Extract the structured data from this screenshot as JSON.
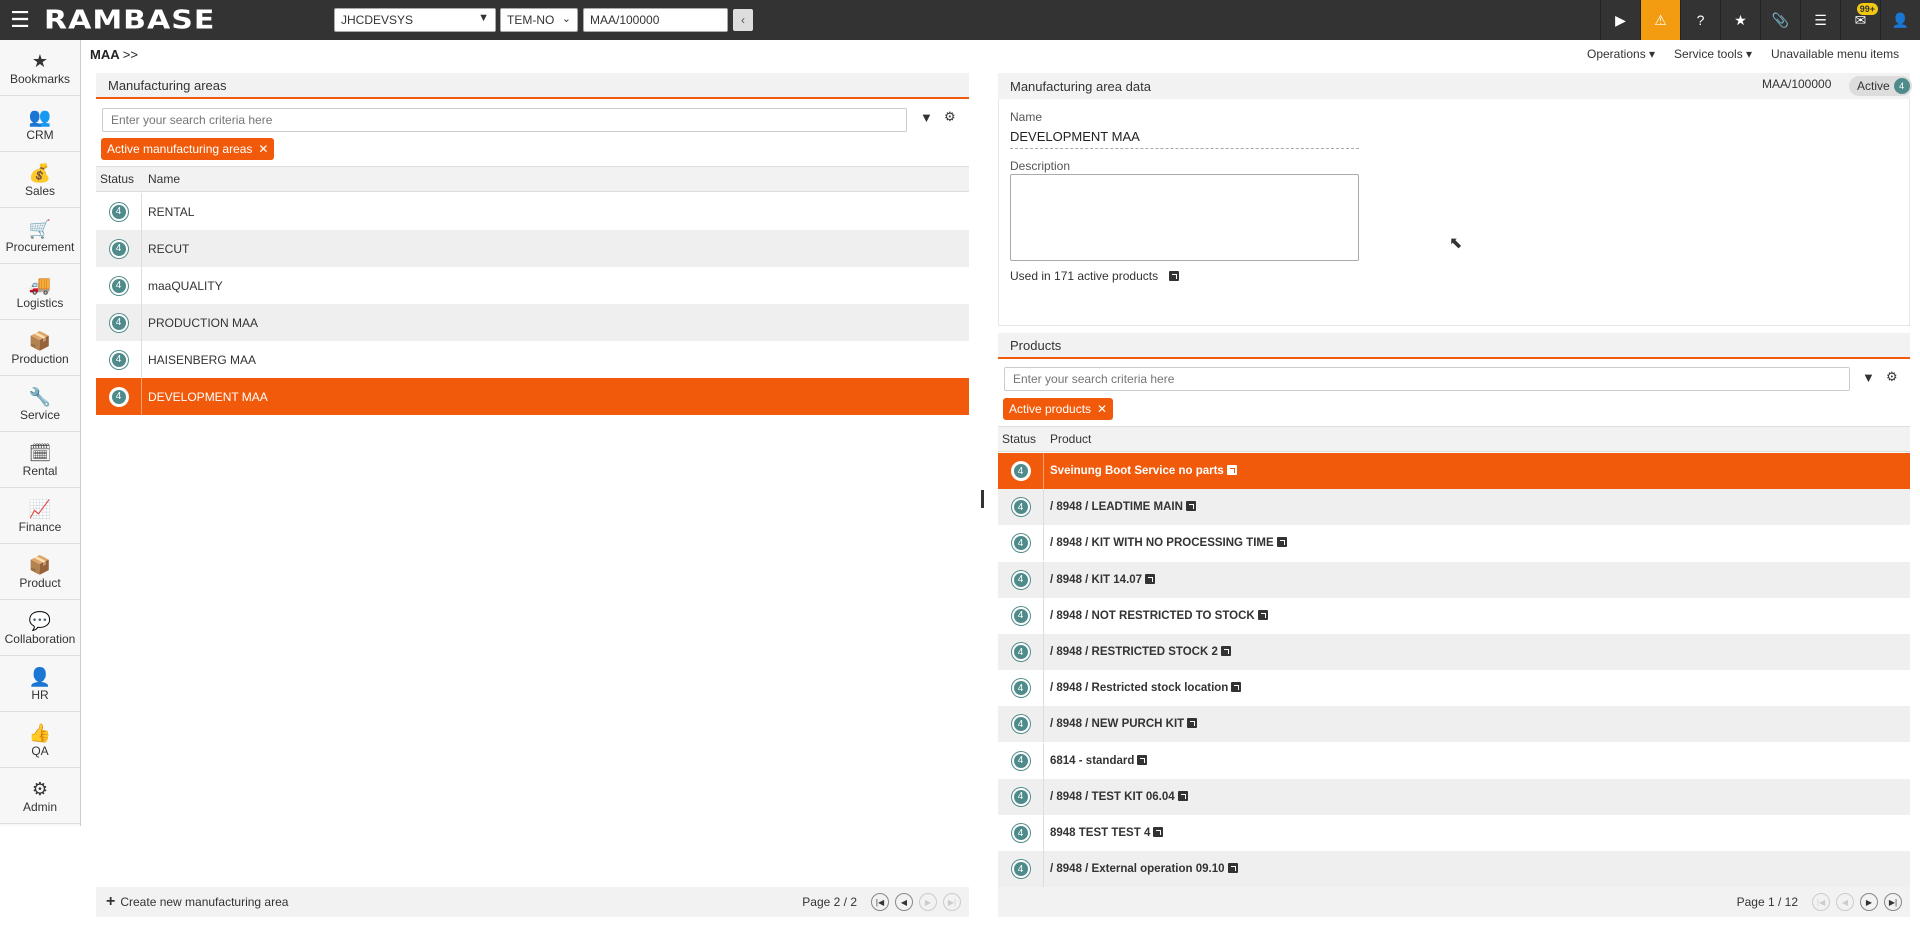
{
  "topbar": {
    "logo": "RAMBASE",
    "company": "JHCDEVSYS",
    "locale": "TEM-NO",
    "doc_id": "MAA/100000",
    "collapse_glyph": "‹",
    "badge": "99+"
  },
  "nav": [
    {
      "label": "Bookmarks",
      "icon": "★"
    },
    {
      "label": "CRM",
      "icon": "👥"
    },
    {
      "label": "Sales",
      "icon": "💰"
    },
    {
      "label": "Procurement",
      "icon": "🛒"
    },
    {
      "label": "Logistics",
      "icon": "🚚"
    },
    {
      "label": "Production",
      "icon": "📦"
    },
    {
      "label": "Service",
      "icon": "🔧"
    },
    {
      "label": "Rental",
      "icon": "🗓"
    },
    {
      "label": "Finance",
      "icon": "📈"
    },
    {
      "label": "Product",
      "icon": "📦"
    },
    {
      "label": "Collaboration",
      "icon": "💬"
    },
    {
      "label": "HR",
      "icon": "👤"
    },
    {
      "label": "QA",
      "icon": "👍"
    },
    {
      "label": "Admin",
      "icon": "⚙"
    }
  ],
  "breadcrumb": {
    "title": "MAA",
    "sep": ">>"
  },
  "menus": {
    "operations": "Operations ▾",
    "service_tools": "Service tools ▾",
    "unavailable": "Unavailable menu items"
  },
  "left": {
    "title": "Manufacturing areas",
    "search_placeholder": "Enter your search criteria here",
    "chip": "Active manufacturing areas",
    "col_status": "Status",
    "col_name": "Name",
    "rows": [
      {
        "status": "4",
        "name": "RENTAL"
      },
      {
        "status": "4",
        "name": "RECUT"
      },
      {
        "status": "4",
        "name": "maaQUALITY"
      },
      {
        "status": "4",
        "name": "PRODUCTION MAA"
      },
      {
        "status": "4",
        "name": "HAISENBERG MAA"
      },
      {
        "status": "4",
        "name": "DEVELOPMENT MAA"
      }
    ],
    "create_label": "Create new manufacturing area",
    "page": "Page 2 / 2"
  },
  "detail": {
    "title": "Manufacturing area data",
    "doc_id": "MAA/100000",
    "status_label": "Active",
    "status_num": "4",
    "name_label": "Name",
    "name_value": "DEVELOPMENT MAA",
    "desc_label": "Description",
    "used_in": "Used in 171 active products"
  },
  "products": {
    "title": "Products",
    "search_placeholder": "Enter your search criteria here",
    "chip": "Active products",
    "col_status": "Status",
    "col_product": "Product",
    "rows": [
      {
        "status": "4",
        "name": "Sveinung Boot Service no parts"
      },
      {
        "status": "4",
        "name": "/ 8948 / LEADTIME MAIN"
      },
      {
        "status": "4",
        "name": "/ 8948 / KIT WITH NO PROCESSING TIME"
      },
      {
        "status": "4",
        "name": "/ 8948 / KIT 14.07"
      },
      {
        "status": "4",
        "name": "/ 8948 / NOT RESTRICTED TO STOCK"
      },
      {
        "status": "4",
        "name": "/ 8948 / RESTRICTED STOCK 2"
      },
      {
        "status": "4",
        "name": "/ 8948 / Restricted stock location"
      },
      {
        "status": "4",
        "name": "/ 8948 / NEW PURCH KIT"
      },
      {
        "status": "4",
        "name": "6814 - standard"
      },
      {
        "status": "4",
        "name": "/ 8948 / TEST KIT 06.04"
      },
      {
        "status": "4",
        "name": "8948 TEST TEST 4"
      },
      {
        "status": "4",
        "name": "/ 8948 / External operation 09.10"
      }
    ],
    "page": "Page 1 / 12"
  }
}
